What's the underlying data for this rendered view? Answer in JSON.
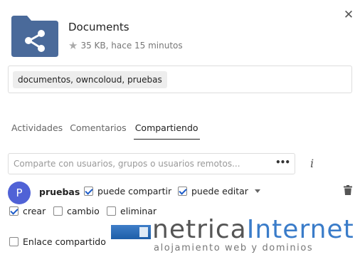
{
  "header": {
    "file_name": "Documents",
    "meta": "35 KB, hace 15 minutos",
    "close_icon": "close-icon",
    "folder_color": "#4a6a9a"
  },
  "tags": {
    "value": "documentos, owncoloud, pruebas"
  },
  "tabs": [
    {
      "label": "Actividades",
      "active": false
    },
    {
      "label": "Comentarios",
      "active": false
    },
    {
      "label": "Compartiendo",
      "active": true
    }
  ],
  "share": {
    "placeholder": "Comparte con usuarios, grupos o usuarios remotos...",
    "menu_label": "•••",
    "info_label": "i"
  },
  "recipient": {
    "avatar_letter": "P",
    "avatar_color": "#5062d6",
    "name": "pruebas",
    "permissions": [
      {
        "label": "puede compartir",
        "checked": true
      },
      {
        "label": "puede editar",
        "checked": true
      },
      {
        "label": "crear",
        "checked": true
      },
      {
        "label": "cambio",
        "checked": false
      },
      {
        "label": "eliminar",
        "checked": false
      }
    ]
  },
  "link_share": {
    "label": "Enlace compartido",
    "checked": false
  },
  "logo": {
    "part1": "netrica",
    "part2": "Internet",
    "tagline": "alojamiento web y dominios",
    "accent": "#3a7cc9"
  }
}
